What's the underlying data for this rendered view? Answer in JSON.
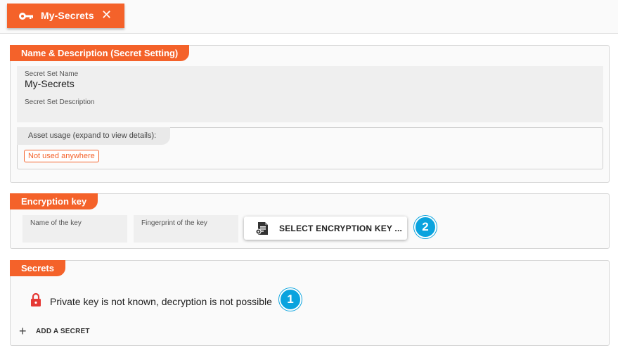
{
  "tab": {
    "title": "My-Secrets",
    "icon": "key-icon",
    "close_icon": "close-icon"
  },
  "sections": {
    "name_description": {
      "title": "Name & Description (Secret Setting)",
      "secret_set_name_label": "Secret Set Name",
      "secret_set_name_value": "My-Secrets",
      "secret_set_description_label": "Secret Set Description",
      "secret_set_description_value": "",
      "asset_usage_label": "Asset usage (expand to view details):",
      "asset_usage_badge": "Not used anywhere"
    },
    "encryption_key": {
      "title": "Encryption key",
      "key_name_label": "Name of the key",
      "fingerprint_label": "Fingerprint of the key",
      "select_button_label": "SELECT ENCRYPTION KEY ...",
      "callout": "2"
    },
    "secrets": {
      "title": "Secrets",
      "warning_text": "Private key is not known, decryption is not possible",
      "callout": "1",
      "add_label": "ADD A SECRET"
    }
  },
  "colors": {
    "accent": "#f4622a",
    "callout": "#0aa3de",
    "lock": "#e53935"
  }
}
